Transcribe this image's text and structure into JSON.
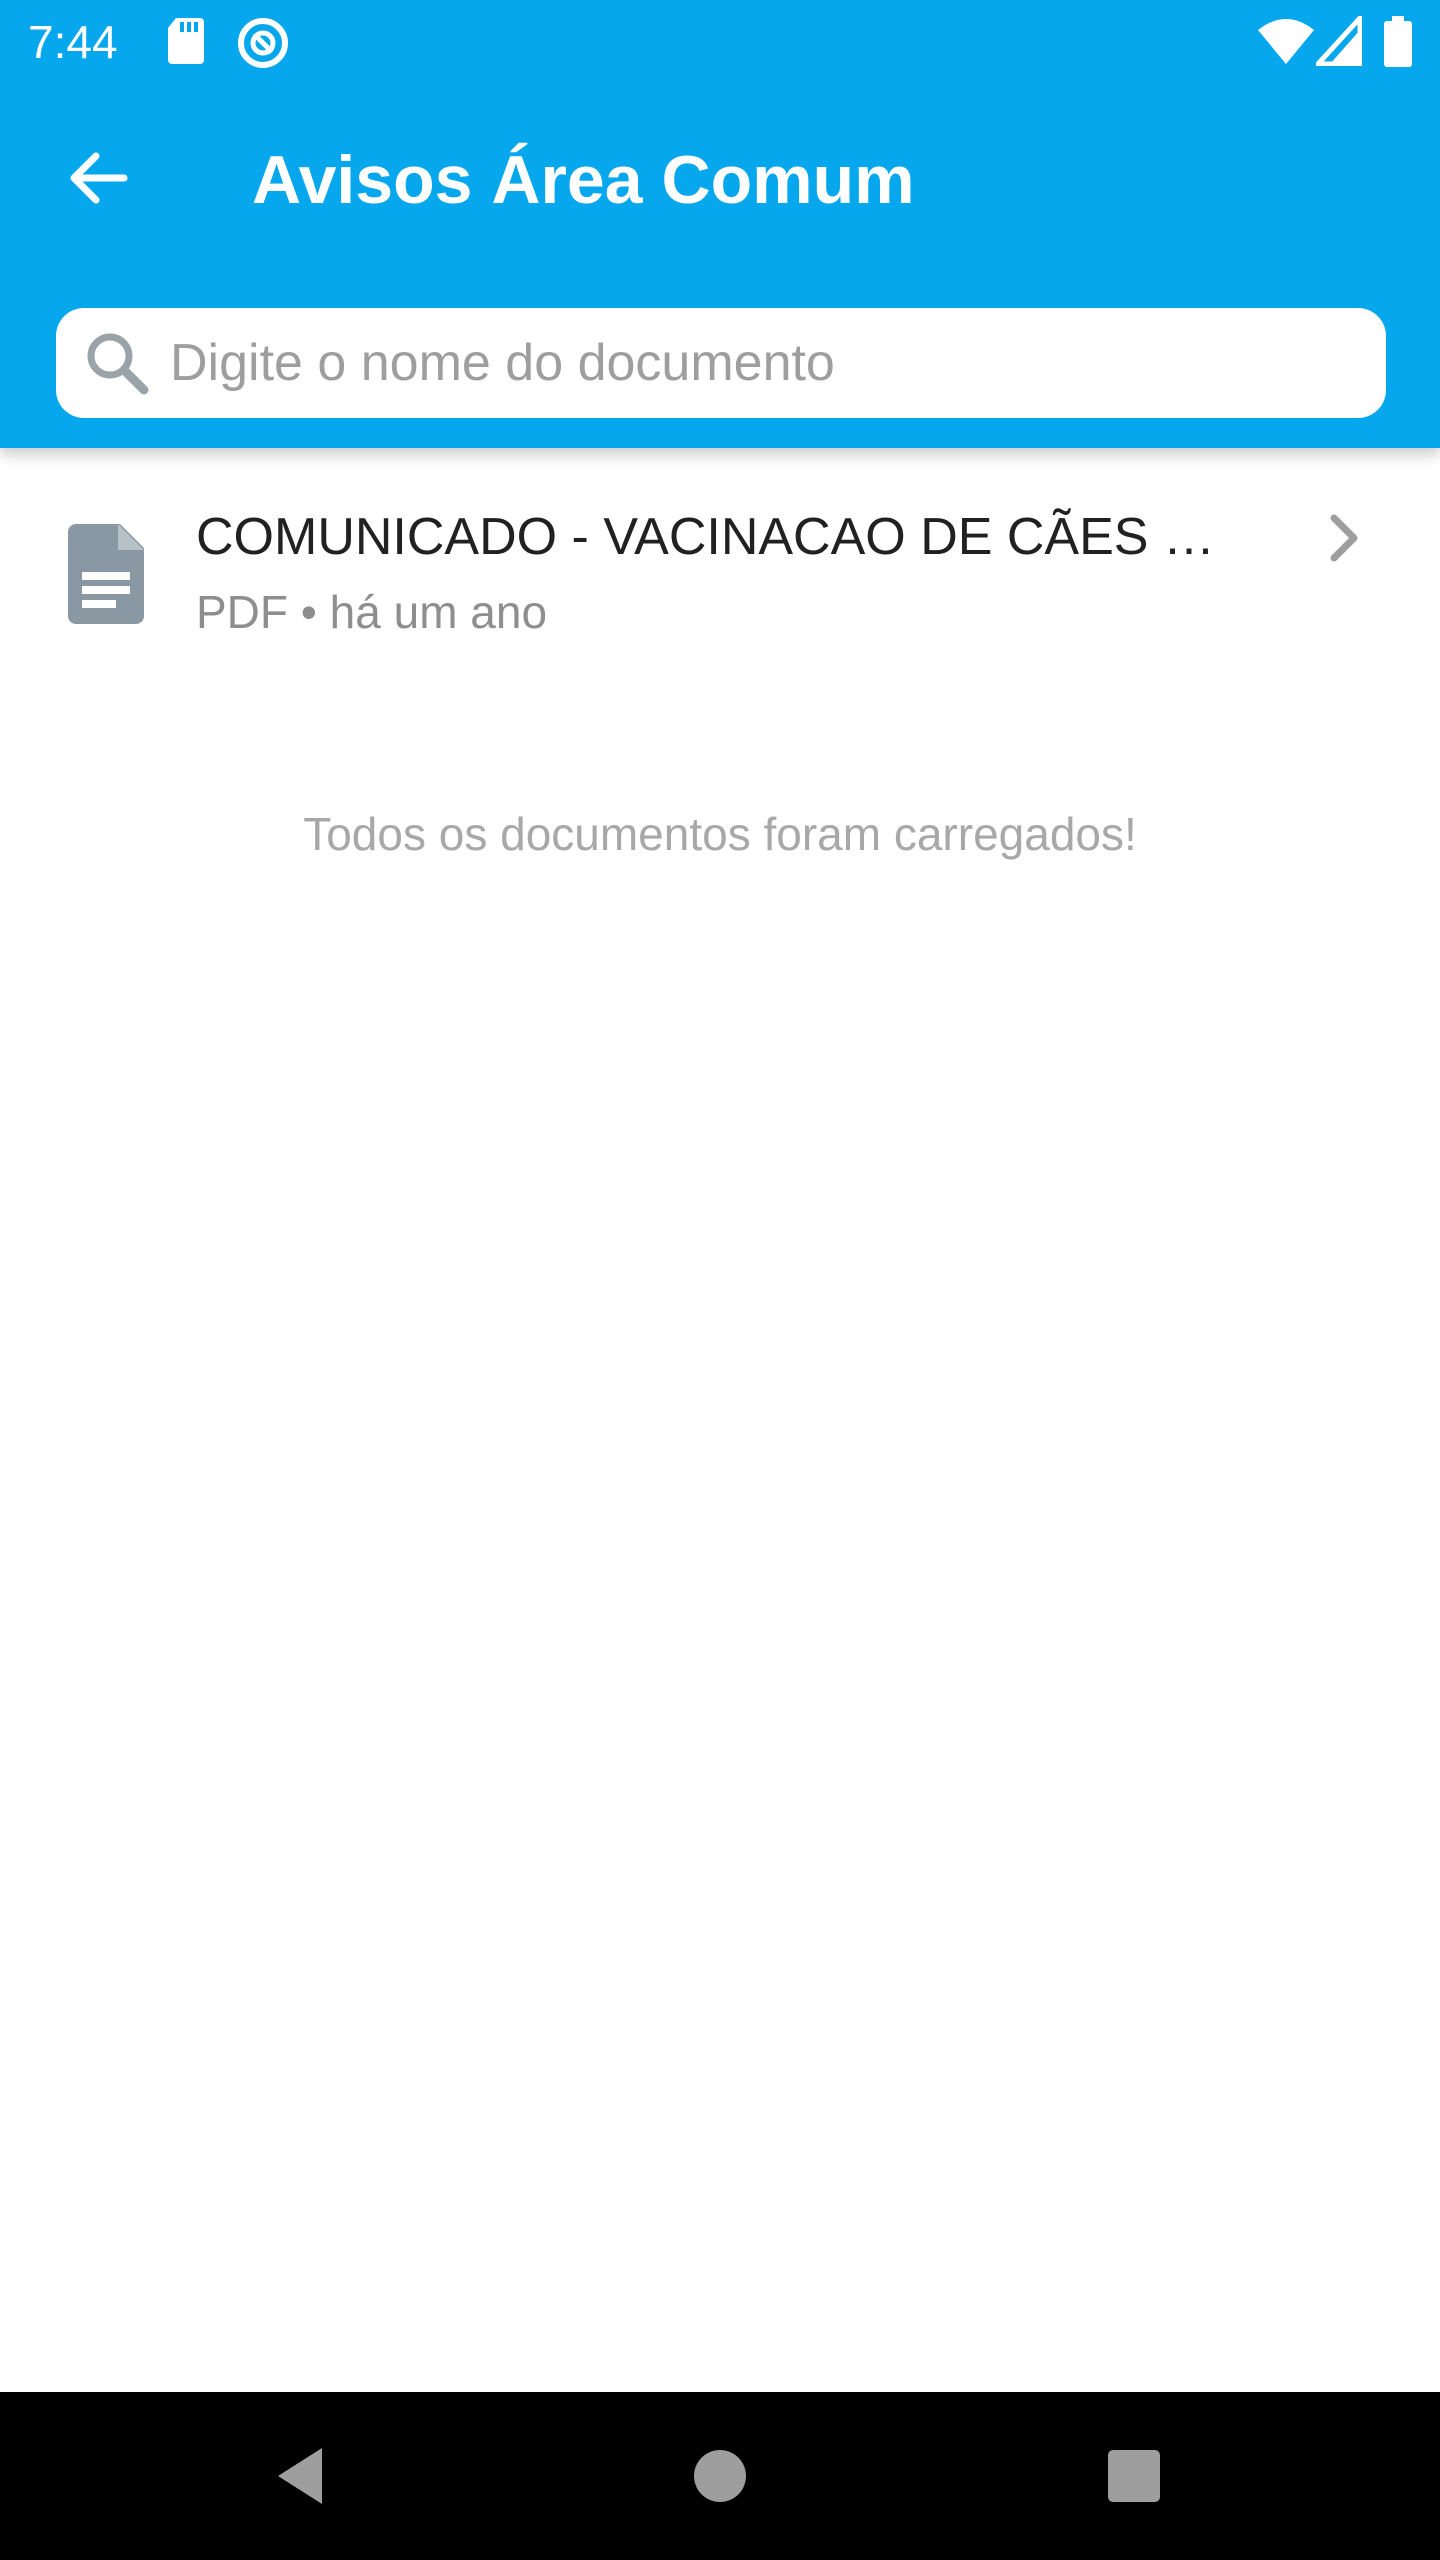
{
  "status_bar": {
    "time": "7:44",
    "icons": [
      "sd-card-icon",
      "sync-icon",
      "wifi-icon",
      "signal-icon",
      "battery-icon"
    ]
  },
  "toolbar": {
    "back_icon": "arrow-back-icon",
    "title": "Avisos Área Comum"
  },
  "search": {
    "placeholder": "Digite o nome do documento",
    "value": ""
  },
  "documents": [
    {
      "icon": "document-icon",
      "title": "COMUNICADO - VACINACAO DE CÃES E ...",
      "meta": "PDF • há um ano"
    }
  ],
  "footer_message": "Todos os documentos foram carregados!",
  "nav_bar": {
    "buttons": [
      "back-triangle-icon",
      "home-circle-icon",
      "recents-square-icon"
    ]
  },
  "colors": {
    "primary": "#06A7EC",
    "icon_gray": "#8A98A3",
    "text_dark": "#212121",
    "text_muted": "#8E8E8E"
  }
}
